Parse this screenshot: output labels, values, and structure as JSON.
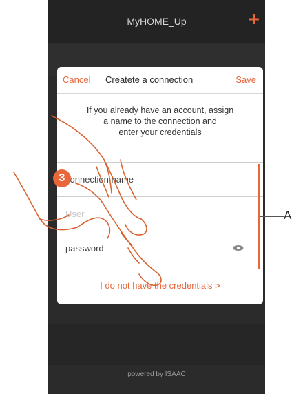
{
  "app": {
    "title": "MyHOME_Up",
    "add_icon": "plus-icon",
    "powered": "powered by ISAAC"
  },
  "dialog": {
    "cancel": "Cancel",
    "title": "Createte a connection",
    "save": "Save",
    "intro_line1": "If you already have an account, assign",
    "intro_line2": "a name to the connection and",
    "intro_line3": "enter your credentials",
    "fields": {
      "connection_name": "connection name",
      "user": "User",
      "password": "password"
    },
    "show_password_icon": "eye-icon",
    "no_credentials": "I do not have the credentials >"
  },
  "annotations": {
    "step": "3",
    "callout": "A"
  },
  "colors": {
    "accent": "#e8663a",
    "background": "#2b2b2b"
  }
}
